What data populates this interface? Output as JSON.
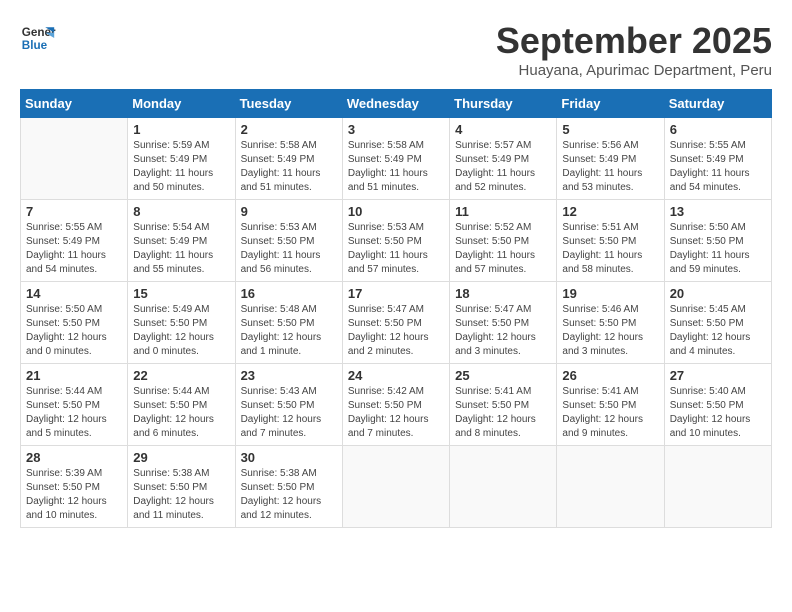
{
  "header": {
    "logo_line1": "General",
    "logo_line2": "Blue",
    "month": "September 2025",
    "location": "Huayana, Apurimac Department, Peru"
  },
  "weekdays": [
    "Sunday",
    "Monday",
    "Tuesday",
    "Wednesday",
    "Thursday",
    "Friday",
    "Saturday"
  ],
  "weeks": [
    [
      {
        "day": "",
        "info": ""
      },
      {
        "day": "1",
        "info": "Sunrise: 5:59 AM\nSunset: 5:49 PM\nDaylight: 11 hours\nand 50 minutes."
      },
      {
        "day": "2",
        "info": "Sunrise: 5:58 AM\nSunset: 5:49 PM\nDaylight: 11 hours\nand 51 minutes."
      },
      {
        "day": "3",
        "info": "Sunrise: 5:58 AM\nSunset: 5:49 PM\nDaylight: 11 hours\nand 51 minutes."
      },
      {
        "day": "4",
        "info": "Sunrise: 5:57 AM\nSunset: 5:49 PM\nDaylight: 11 hours\nand 52 minutes."
      },
      {
        "day": "5",
        "info": "Sunrise: 5:56 AM\nSunset: 5:49 PM\nDaylight: 11 hours\nand 53 minutes."
      },
      {
        "day": "6",
        "info": "Sunrise: 5:55 AM\nSunset: 5:49 PM\nDaylight: 11 hours\nand 54 minutes."
      }
    ],
    [
      {
        "day": "7",
        "info": "Sunrise: 5:55 AM\nSunset: 5:49 PM\nDaylight: 11 hours\nand 54 minutes."
      },
      {
        "day": "8",
        "info": "Sunrise: 5:54 AM\nSunset: 5:49 PM\nDaylight: 11 hours\nand 55 minutes."
      },
      {
        "day": "9",
        "info": "Sunrise: 5:53 AM\nSunset: 5:50 PM\nDaylight: 11 hours\nand 56 minutes."
      },
      {
        "day": "10",
        "info": "Sunrise: 5:53 AM\nSunset: 5:50 PM\nDaylight: 11 hours\nand 57 minutes."
      },
      {
        "day": "11",
        "info": "Sunrise: 5:52 AM\nSunset: 5:50 PM\nDaylight: 11 hours\nand 57 minutes."
      },
      {
        "day": "12",
        "info": "Sunrise: 5:51 AM\nSunset: 5:50 PM\nDaylight: 11 hours\nand 58 minutes."
      },
      {
        "day": "13",
        "info": "Sunrise: 5:50 AM\nSunset: 5:50 PM\nDaylight: 11 hours\nand 59 minutes."
      }
    ],
    [
      {
        "day": "14",
        "info": "Sunrise: 5:50 AM\nSunset: 5:50 PM\nDaylight: 12 hours\nand 0 minutes."
      },
      {
        "day": "15",
        "info": "Sunrise: 5:49 AM\nSunset: 5:50 PM\nDaylight: 12 hours\nand 0 minutes."
      },
      {
        "day": "16",
        "info": "Sunrise: 5:48 AM\nSunset: 5:50 PM\nDaylight: 12 hours\nand 1 minute."
      },
      {
        "day": "17",
        "info": "Sunrise: 5:47 AM\nSunset: 5:50 PM\nDaylight: 12 hours\nand 2 minutes."
      },
      {
        "day": "18",
        "info": "Sunrise: 5:47 AM\nSunset: 5:50 PM\nDaylight: 12 hours\nand 3 minutes."
      },
      {
        "day": "19",
        "info": "Sunrise: 5:46 AM\nSunset: 5:50 PM\nDaylight: 12 hours\nand 3 minutes."
      },
      {
        "day": "20",
        "info": "Sunrise: 5:45 AM\nSunset: 5:50 PM\nDaylight: 12 hours\nand 4 minutes."
      }
    ],
    [
      {
        "day": "21",
        "info": "Sunrise: 5:44 AM\nSunset: 5:50 PM\nDaylight: 12 hours\nand 5 minutes."
      },
      {
        "day": "22",
        "info": "Sunrise: 5:44 AM\nSunset: 5:50 PM\nDaylight: 12 hours\nand 6 minutes."
      },
      {
        "day": "23",
        "info": "Sunrise: 5:43 AM\nSunset: 5:50 PM\nDaylight: 12 hours\nand 7 minutes."
      },
      {
        "day": "24",
        "info": "Sunrise: 5:42 AM\nSunset: 5:50 PM\nDaylight: 12 hours\nand 7 minutes."
      },
      {
        "day": "25",
        "info": "Sunrise: 5:41 AM\nSunset: 5:50 PM\nDaylight: 12 hours\nand 8 minutes."
      },
      {
        "day": "26",
        "info": "Sunrise: 5:41 AM\nSunset: 5:50 PM\nDaylight: 12 hours\nand 9 minutes."
      },
      {
        "day": "27",
        "info": "Sunrise: 5:40 AM\nSunset: 5:50 PM\nDaylight: 12 hours\nand 10 minutes."
      }
    ],
    [
      {
        "day": "28",
        "info": "Sunrise: 5:39 AM\nSunset: 5:50 PM\nDaylight: 12 hours\nand 10 minutes."
      },
      {
        "day": "29",
        "info": "Sunrise: 5:38 AM\nSunset: 5:50 PM\nDaylight: 12 hours\nand 11 minutes."
      },
      {
        "day": "30",
        "info": "Sunrise: 5:38 AM\nSunset: 5:50 PM\nDaylight: 12 hours\nand 12 minutes."
      },
      {
        "day": "",
        "info": ""
      },
      {
        "day": "",
        "info": ""
      },
      {
        "day": "",
        "info": ""
      },
      {
        "day": "",
        "info": ""
      }
    ]
  ]
}
